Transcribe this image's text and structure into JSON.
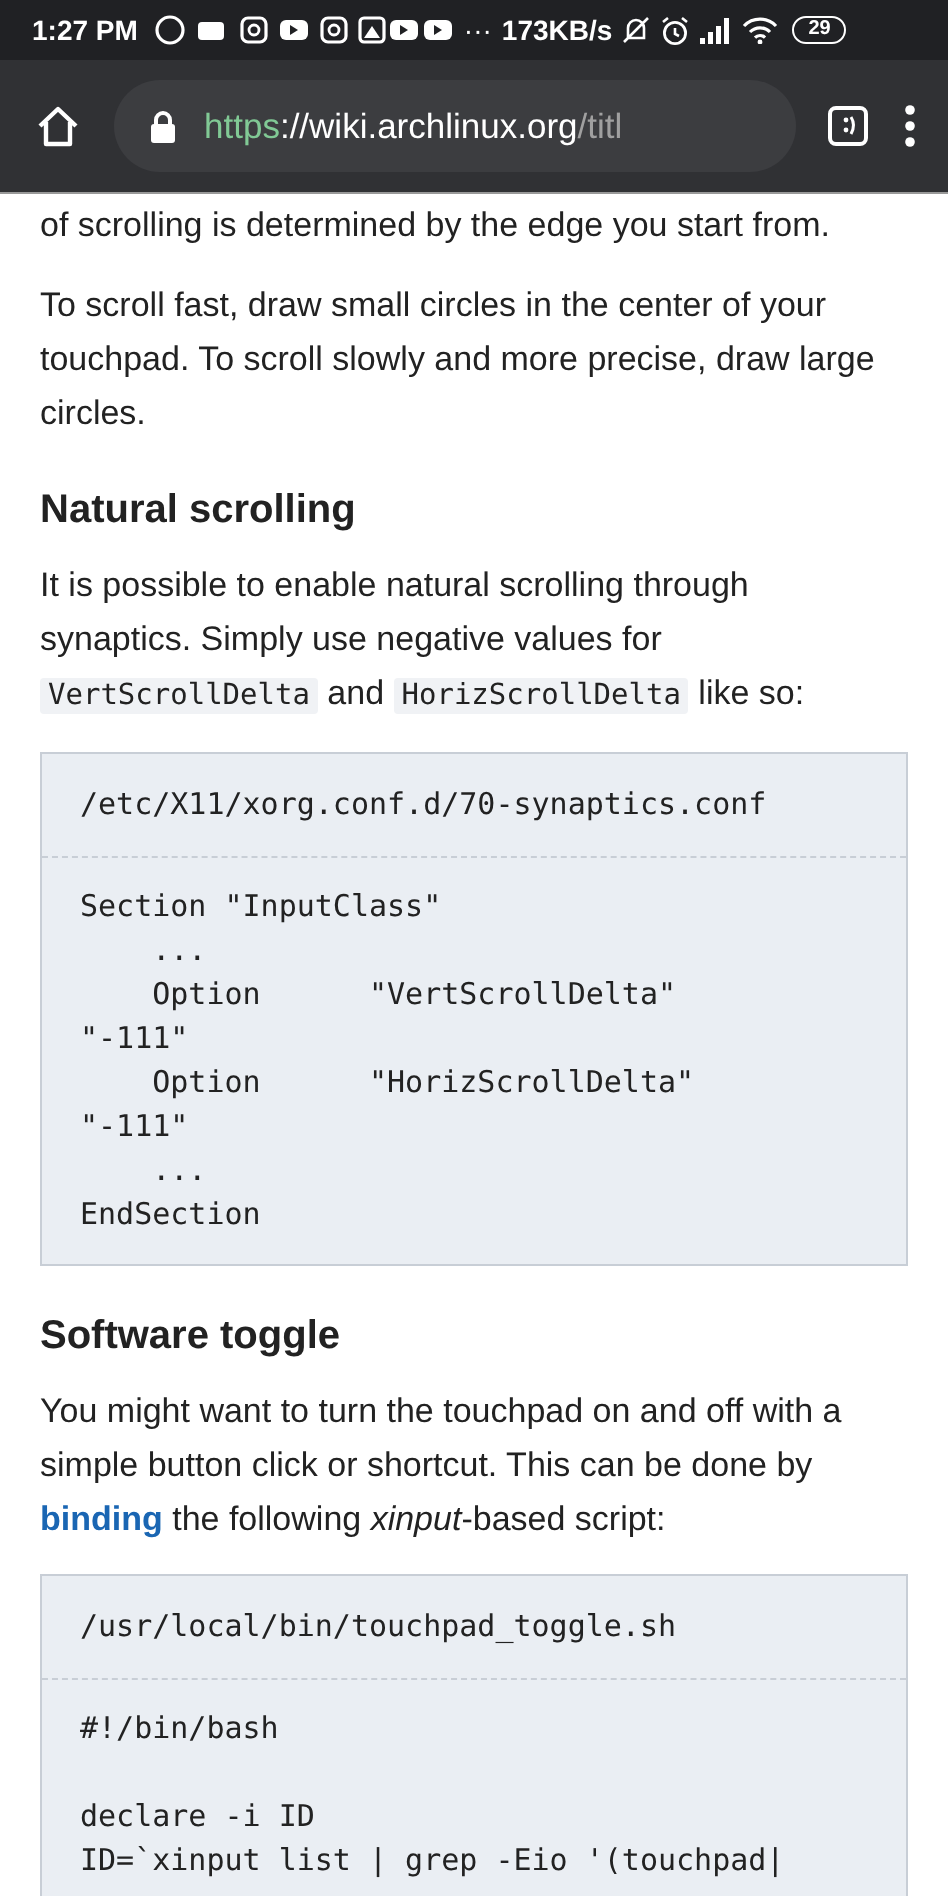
{
  "status_bar": {
    "time": "1:27 PM",
    "more": "···",
    "speed": "173KB/s",
    "battery": "29"
  },
  "toolbar": {
    "url": [
      {
        "kind": "scheme",
        "text": "https"
      },
      {
        "kind": "host",
        "text": "://wiki.archlinux.org"
      },
      {
        "kind": "path",
        "text": "/titl"
      }
    ]
  },
  "content": [
    {
      "kind": "paragraph",
      "segments": [
        {
          "kind": "text",
          "text": "of scrolling is determined by the edge you start from."
        }
      ]
    },
    {
      "kind": "paragraph",
      "segments": [
        {
          "kind": "text",
          "text": "To scroll fast, draw small circles in the center of your touchpad. To scroll slowly and more precise, draw large circles."
        }
      ]
    },
    {
      "kind": "heading",
      "text": "Natural scrolling"
    },
    {
      "kind": "paragraph",
      "segments": [
        {
          "kind": "text",
          "text": "It is possible to enable natural scrolling through synaptics. Simply use negative values for "
        },
        {
          "kind": "code",
          "text": "VertScrollDelta"
        },
        {
          "kind": "text",
          "text": " and "
        },
        {
          "kind": "code",
          "text": "HorizScrollDelta"
        },
        {
          "kind": "text",
          "text": " like so:"
        }
      ]
    },
    {
      "kind": "codebox",
      "file": "/etc/X11/xorg.conf.d/70-synaptics.conf",
      "code": "Section \"InputClass\"\n    ...\n    Option      \"VertScrollDelta\"\n\"-111\"\n    Option      \"HorizScrollDelta\"\n\"-111\"\n    ...\nEndSection"
    },
    {
      "kind": "heading",
      "text": "Software toggle"
    },
    {
      "kind": "paragraph",
      "segments": [
        {
          "kind": "text",
          "text": "You might want to turn the touchpad on and off with a simple button click or shortcut. This can be done by "
        },
        {
          "kind": "link",
          "text": "binding"
        },
        {
          "kind": "text",
          "text": " the following *xinput*-based script:"
        }
      ]
    },
    {
      "kind": "codebox",
      "file": "/usr/local/bin/touchpad_toggle.sh",
      "code": "#!/bin/bash\n\ndeclare -i ID\nID=`xinput list | grep -Eio '(touchpad|"
    }
  ]
}
